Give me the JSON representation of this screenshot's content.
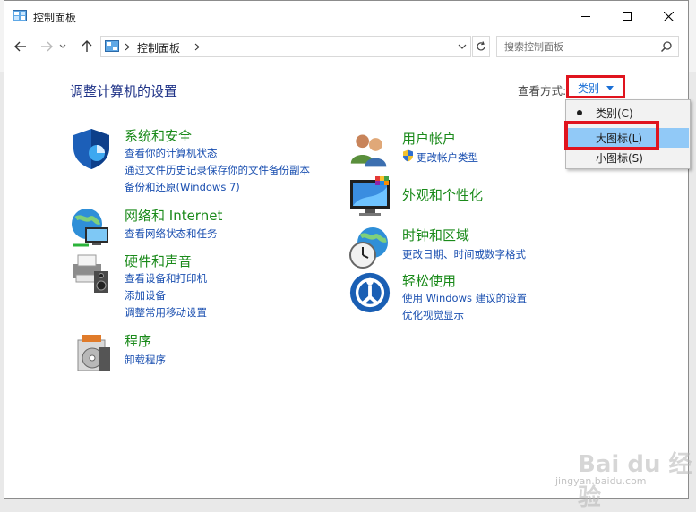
{
  "window": {
    "title": "控制面板",
    "icon": "control-panel-icon"
  },
  "nav": {
    "breadcrumb_root": "控制面板",
    "search_placeholder": "搜索控制面板"
  },
  "main": {
    "heading": "调整计算机的设置",
    "view_by_label": "查看方式:",
    "view_by_value": "类别"
  },
  "view_menu": {
    "items": [
      {
        "label": "类别(C)",
        "selected": true
      },
      {
        "label": "大图标(L)",
        "highlighted": true
      },
      {
        "label": "小图标(S)"
      }
    ]
  },
  "categories": [
    {
      "icon": "shield-icon",
      "title": "系统和安全",
      "links": [
        "查看你的计算机状态",
        "通过文件历史记录保存你的文件备份副本",
        "备份和还原(Windows 7)"
      ]
    },
    {
      "icon": "network-globe-icon",
      "title": "网络和 Internet",
      "links": [
        "查看网络状态和任务"
      ]
    },
    {
      "icon": "printer-speaker-icon",
      "title": "硬件和声音",
      "links": [
        "查看设备和打印机",
        "添加设备",
        "调整常用移动设置"
      ]
    },
    {
      "icon": "programs-disc-icon",
      "title": "程序",
      "links": [
        "卸载程序"
      ]
    },
    {
      "icon": "users-icon",
      "title": "用户帐户",
      "links": [
        "更改帐户类型"
      ]
    },
    {
      "icon": "monitor-palette-icon",
      "title": "外观和个性化",
      "links": []
    },
    {
      "icon": "globe-clock-icon",
      "title": "时钟和区域",
      "links": [
        "更改日期、时间或数字格式"
      ]
    },
    {
      "icon": "ease-of-access-icon",
      "title": "轻松使用",
      "links": [
        "使用 Windows 建议的设置",
        "优化视觉显示"
      ]
    }
  ],
  "watermark": {
    "text": "Bai du 经验",
    "sub": "jingyan.baidu.com"
  },
  "colors": {
    "category_title": "#1a8a1a",
    "link": "#1a4fb0",
    "heading": "#1e3287",
    "highlight_box": "#e0141e",
    "menu_highlight": "#91c9f7"
  }
}
